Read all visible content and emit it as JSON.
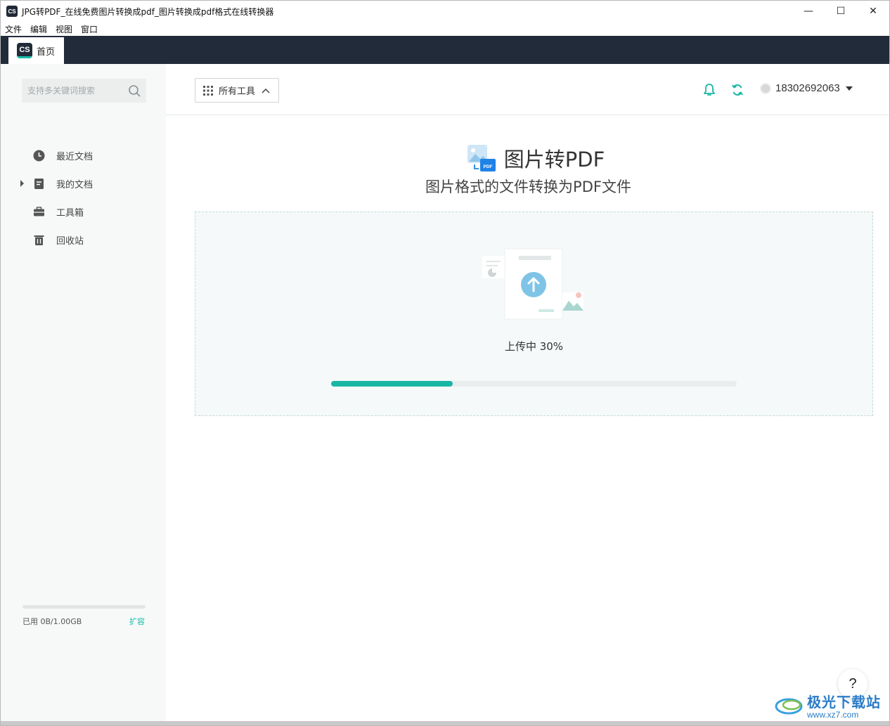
{
  "window": {
    "title": "JPG转PDF_在线免费图片转换成pdf_图片转换成pdf格式在线转换器",
    "app_icon_text": "CS",
    "controls": {
      "minimize": "—",
      "maximize": "☐",
      "close": "✕"
    }
  },
  "menu": [
    "文件",
    "编辑",
    "视图",
    "窗口"
  ],
  "tab": {
    "logo": "CS",
    "label": "首页"
  },
  "sidebar": {
    "search_placeholder": "支持多关键词搜索",
    "items": [
      {
        "label": "最近文档",
        "icon": "clock-icon"
      },
      {
        "label": "我的文档",
        "icon": "document-icon"
      },
      {
        "label": "工具箱",
        "icon": "toolbox-icon"
      },
      {
        "label": "回收站",
        "icon": "trash-icon"
      }
    ],
    "storage": {
      "used_text": "已用 0B/1.00GB",
      "expand_label": "扩容",
      "used_fraction": 0
    }
  },
  "topbar": {
    "tools_label": "所有工具",
    "account": "18302692063"
  },
  "feature": {
    "title": "图片转PDF",
    "subtitle": "图片格式的文件转换为PDF文件",
    "badge": "PDF"
  },
  "upload": {
    "status_text": "上传中 30%",
    "progress": 0.3
  },
  "help": {
    "label": "?"
  },
  "watermark": {
    "name": "极光下载站",
    "url": "www.xz7.com"
  },
  "colors": {
    "accent": "#19b6a6",
    "tabbar": "#212b3a",
    "sidebar_bg": "#f7f8f8"
  }
}
